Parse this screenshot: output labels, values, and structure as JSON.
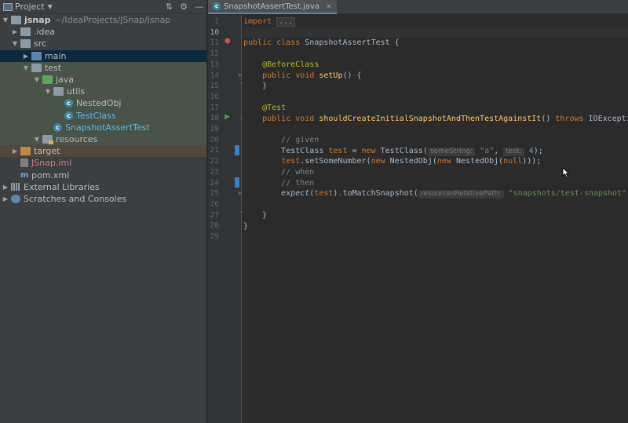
{
  "project_panel": {
    "title": "Project",
    "tree": [
      {
        "label": "jsnap",
        "path": "~/IdeaProjects/JSnap/jsnap",
        "icon": "project-folder-icon",
        "expanded": true
      },
      {
        "label": ".idea",
        "icon": "folder-icon",
        "expanded": false
      },
      {
        "label": "src",
        "icon": "folder-icon",
        "expanded": true
      },
      {
        "label": "main",
        "icon": "source-folder-icon",
        "expanded": false,
        "selected": true
      },
      {
        "label": "test",
        "icon": "folder-icon",
        "expanded": true
      },
      {
        "label": "java",
        "icon": "test-source-folder-icon",
        "expanded": true
      },
      {
        "label": "utils",
        "icon": "package-icon",
        "expanded": true
      },
      {
        "label": "NestedObj",
        "icon": "class-icon"
      },
      {
        "label": "TestClass",
        "icon": "class-icon"
      },
      {
        "label": "SnapshotAssertTest",
        "icon": "test-class-icon"
      },
      {
        "label": "resources",
        "icon": "test-resources-folder-icon",
        "expanded": false
      },
      {
        "label": "target",
        "icon": "excluded-folder-icon",
        "expanded": false
      },
      {
        "label": "JSnap.iml",
        "icon": "iml-file-icon"
      },
      {
        "label": "pom.xml",
        "icon": "maven-file-icon"
      },
      {
        "label": "External Libraries",
        "icon": "libraries-icon",
        "expanded": false
      },
      {
        "label": "Scratches and Consoles",
        "icon": "scratches-icon",
        "expanded": false
      }
    ]
  },
  "editor": {
    "tab_label": "SnapshotAssertTest.java",
    "lines": {
      "l1": {
        "num": "1",
        "import_kw": "import",
        "fold": "..."
      },
      "l10": {
        "num": "10"
      },
      "l11": {
        "num": "11",
        "kw": "public class",
        "name": "SnapshotAssertTest",
        "rest": " {"
      },
      "l12": {
        "num": "12"
      },
      "l13": {
        "num": "13",
        "ann": "@BeforeClass"
      },
      "l14": {
        "num": "14",
        "kw": "public void",
        "fn": "setUp",
        "rest": "() {"
      },
      "l15": {
        "num": "15",
        "text": "}"
      },
      "l16": {
        "num": "16"
      },
      "l17": {
        "num": "17",
        "ann": "@Test"
      },
      "l18": {
        "num": "18",
        "kw": "public void",
        "fn": "shouldCreateInitialSnapshotAndThenTestAgainstIt",
        "mid": "() ",
        "kw2": "throws",
        "rest": " IOException {"
      },
      "l19": {
        "num": "19"
      },
      "l20": {
        "num": "20",
        "comment": "// given"
      },
      "l21": {
        "num": "21",
        "a": "TestClass ",
        "b": "test",
        "c": " = ",
        "kw": "new",
        "d": " TestClass(",
        "hint1": "someString:",
        "str": "\"a\"",
        "comma": ", ",
        "hint2": "test:",
        "num2": "4",
        "e": ");"
      },
      "l22": {
        "num": "22",
        "a": "test",
        "b": ".setSomeNumber(",
        "kw": "new",
        "c": " NestedObj(",
        "kw2": "new",
        "d": " NestedObj(",
        "kw3": "null",
        "e": ")));"
      },
      "l23": {
        "num": "23",
        "comment": "// when"
      },
      "l24": {
        "num": "24",
        "comment": "// then"
      },
      "l25": {
        "num": "25",
        "fn": "expect",
        "a": "(",
        "b": "test",
        "c": ").toMatchSnapshot(",
        "hint": "resourcesRelativePath:",
        "str": "\"snapshots/test-snapshot\"",
        "e": ");"
      },
      "l26": {
        "num": "26"
      },
      "l27": {
        "num": "27",
        "text": "}"
      },
      "l28": {
        "num": "28",
        "text": "}"
      },
      "l29": {
        "num": "29"
      }
    }
  },
  "colors": {
    "background": "#2b2b2b",
    "panel": "#3c3f41",
    "keyword": "#cc7832",
    "annotation": "#bbb529",
    "function": "#ffc66d",
    "string": "#6a8759",
    "number": "#6897bb",
    "comment": "#808080",
    "selection": "#0d293e"
  }
}
